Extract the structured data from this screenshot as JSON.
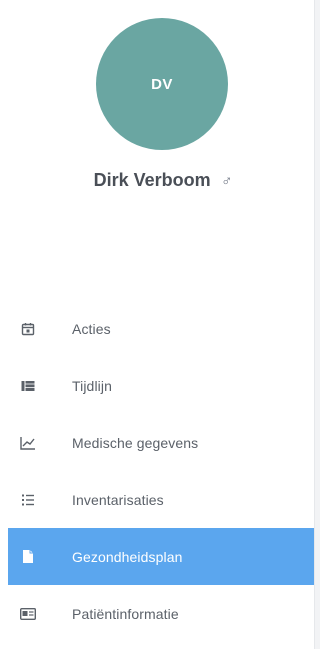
{
  "profile": {
    "initials": "DV",
    "name": "Dirk Verboom",
    "gender_symbol": "♂",
    "avatar_color": "#6aa6a2"
  },
  "nav": {
    "items": [
      {
        "label": "Acties",
        "icon": "calendar-icon",
        "active": false
      },
      {
        "label": "Tijdlijn",
        "icon": "timeline-icon",
        "active": false
      },
      {
        "label": "Medische gegevens",
        "icon": "chart-line-icon",
        "active": false
      },
      {
        "label": "Inventarisaties",
        "icon": "list-icon",
        "active": false
      },
      {
        "label": "Gezondheidsplan",
        "icon": "document-icon",
        "active": true
      },
      {
        "label": "Patiëntinformatie",
        "icon": "id-card-icon",
        "active": false
      }
    ],
    "active_color": "#5ba6ee"
  }
}
